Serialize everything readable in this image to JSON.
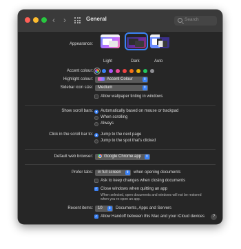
{
  "window": {
    "title": "General"
  },
  "toolbar": {
    "back": "‹",
    "forward": "›",
    "search_placeholder": "Search"
  },
  "appearance": {
    "label": "Appearance:",
    "options": [
      "Light",
      "Dark",
      "Auto"
    ],
    "selected": "Dark"
  },
  "accent": {
    "label": "Accent colour:",
    "colors": [
      "#c0c0c0",
      "#3b82f6",
      "#a855f7",
      "#ec4899",
      "#ef4444",
      "#f97316",
      "#eab308",
      "#22c55e",
      "#8e8e93"
    ],
    "selected_index": 0
  },
  "highlight": {
    "label": "Highlight colour:",
    "value": "Accent Colour"
  },
  "sidebar_icon": {
    "label": "Sidebar icon size:",
    "value": "Medium"
  },
  "wallpaper_tinting": {
    "label": "Allow wallpaper tinting in windows",
    "checked": false
  },
  "scroll_bars": {
    "label": "Show scroll bars:",
    "options": [
      "Automatically based on mouse or trackpad",
      "When scrolling",
      "Always"
    ],
    "selected_index": 0
  },
  "click_scroll": {
    "label": "Click in the scroll bar to:",
    "options": [
      "Jump to the next page",
      "Jump to the spot that's clicked"
    ],
    "selected_index": 0
  },
  "browser": {
    "label": "Default web browser:",
    "value": "Google Chrome.app"
  },
  "tabs": {
    "label": "Prefer tabs:",
    "value": "in full screen",
    "suffix": "when opening documents"
  },
  "ask_keep": {
    "label": "Ask to keep changes when closing documents",
    "checked": false
  },
  "close_windows": {
    "label": "Close windows when quitting an app",
    "checked": true,
    "note_line1": "When selected, open documents and windows will not be restored",
    "note_line2": "when you re-open an app."
  },
  "recent": {
    "label": "Recent items:",
    "value": "10",
    "suffix": "Documents, Apps and Servers"
  },
  "handoff": {
    "label": "Allow Handoff between this Mac and your iCloud devices",
    "checked": true
  },
  "help": "?"
}
